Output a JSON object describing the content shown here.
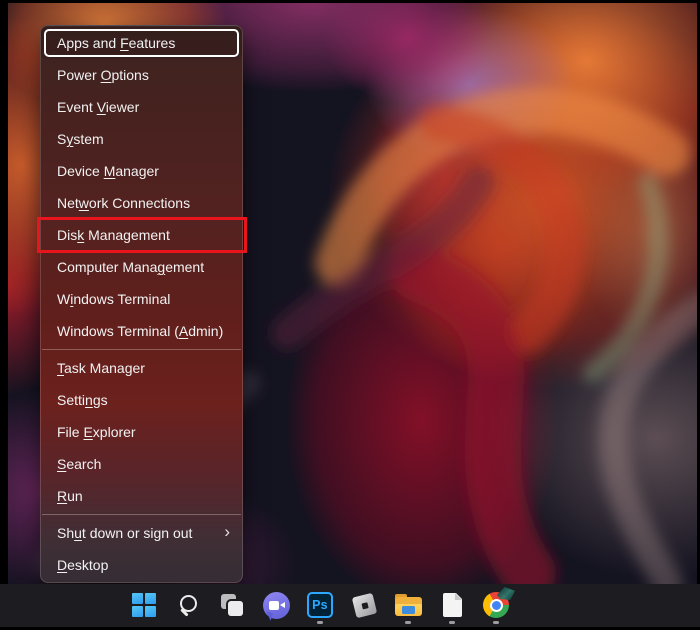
{
  "menu": {
    "submenu_chevron": "›",
    "items": [
      {
        "label": "Apps and Features",
        "underline": 9,
        "focused": true
      },
      {
        "label": "Power Options",
        "underline": 6
      },
      {
        "label": "Event Viewer",
        "underline": 6
      },
      {
        "label": "System",
        "underline": 1
      },
      {
        "label": "Device Manager",
        "underline": 7
      },
      {
        "label": "Network Connections",
        "underline": 3
      },
      {
        "label": "Disk Management",
        "underline": 3,
        "annotated": true
      },
      {
        "label": "Computer Management",
        "underline": 13
      },
      {
        "label": "Windows Terminal",
        "underline": 1
      },
      {
        "label": "Windows Terminal (Admin)",
        "underline": 18
      },
      {
        "type": "separator"
      },
      {
        "label": "Task Manager",
        "underline": 0
      },
      {
        "label": "Settings",
        "underline": 5
      },
      {
        "label": "File Explorer",
        "underline": 5
      },
      {
        "label": "Search",
        "underline": 0
      },
      {
        "label": "Run",
        "underline": 0
      },
      {
        "type": "separator"
      },
      {
        "label": "Shut down or sign out",
        "underline": 2,
        "submenu": true
      },
      {
        "label": "Desktop",
        "underline": 0
      }
    ]
  },
  "taskbar": {
    "icons": [
      {
        "name": "start",
        "running": false
      },
      {
        "name": "search",
        "running": false
      },
      {
        "name": "task-view",
        "running": false
      },
      {
        "name": "chat",
        "running": false
      },
      {
        "name": "photoshop",
        "text": "Ps",
        "running": true
      },
      {
        "name": "roblox",
        "running": false
      },
      {
        "name": "file-explorer",
        "running": true
      },
      {
        "name": "notepad",
        "running": true
      },
      {
        "name": "chrome",
        "running": true
      }
    ]
  },
  "colors": {
    "annotation_red": "#e8151c",
    "focus_ring": "#ffffff",
    "menu_text": "#f2f2f2",
    "taskbar_bg": "#1d1c20",
    "start_blue": "#2f9bee",
    "chat_purple": "#5f5fd6",
    "ps_bg": "#002236",
    "ps_border": "#2ea8ff",
    "folder_yellow": "#f9bd3f",
    "chrome_red": "#ea4335",
    "chrome_yellow": "#fbbc05",
    "chrome_green": "#34a853",
    "chrome_blue": "#4285f4"
  }
}
